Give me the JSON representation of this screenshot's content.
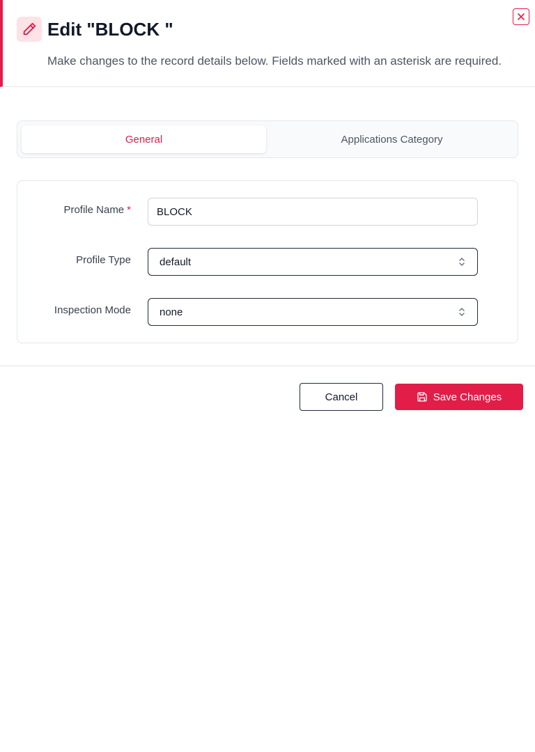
{
  "header": {
    "title": "Edit \"BLOCK \"",
    "subtitle": "Make changes to the record details below. Fields marked with an asterisk are required.",
    "icon": "pencil-icon",
    "close_icon": "close-icon"
  },
  "tabs": [
    {
      "label": "General",
      "active": true
    },
    {
      "label": "Applications Category",
      "active": false
    }
  ],
  "form": {
    "profile_name": {
      "label": "Profile Name",
      "required_mark": "*",
      "value": "BLOCK"
    },
    "profile_type": {
      "label": "Profile Type",
      "value": "default"
    },
    "inspection_mode": {
      "label": "Inspection Mode",
      "value": "none"
    }
  },
  "footer": {
    "cancel_label": "Cancel",
    "save_label": "Save Changes",
    "save_icon": "save-icon"
  },
  "colors": {
    "accent": "#e11d48",
    "accent_light": "#fde2e7"
  }
}
